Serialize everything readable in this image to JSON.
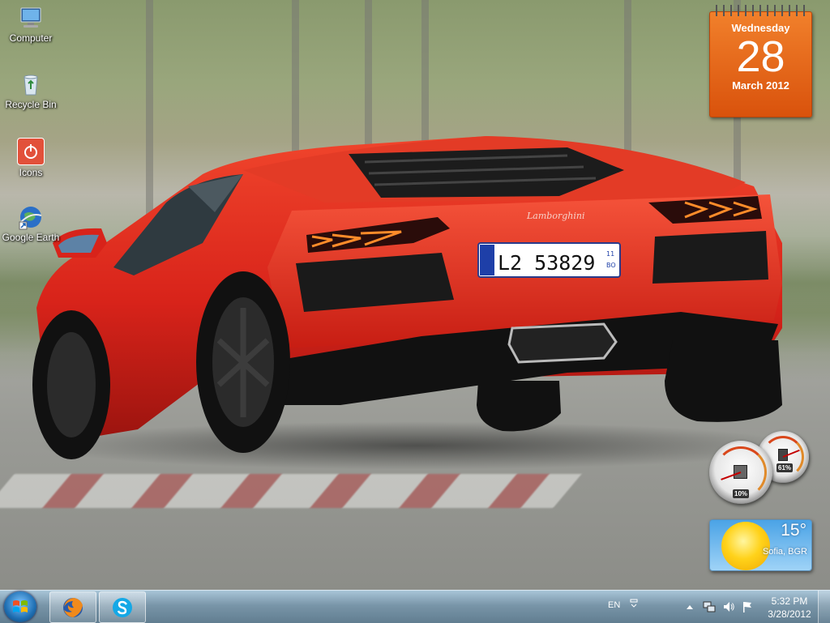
{
  "desktop": {
    "icons": [
      {
        "label": "Computer",
        "icon": "computer-icon"
      },
      {
        "label": "Recycle Bin",
        "icon": "recycle-bin-icon"
      },
      {
        "label": "Icons",
        "icon": "power-icon"
      },
      {
        "label": "Google Earth",
        "icon": "google-earth-icon"
      }
    ],
    "wallpaper": {
      "license_plate": "L2 53829",
      "plate_year": "11",
      "plate_province": "BO",
      "badge": "Lamborghini"
    }
  },
  "gadgets": {
    "calendar": {
      "weekday": "Wednesday",
      "day": "28",
      "month_year": "March 2012"
    },
    "meter": {
      "cpu_label": "10%",
      "ram_label": "61%"
    },
    "weather": {
      "temperature": "15°",
      "location": "Sofia, BGR"
    }
  },
  "taskbar": {
    "pinned": [
      {
        "name": "firefox",
        "icon": "firefox-icon"
      },
      {
        "name": "skype",
        "icon": "skype-icon"
      }
    ],
    "language": "EN",
    "clock": {
      "time": "5:32 PM",
      "date": "3/28/2012"
    }
  },
  "colors": {
    "calendar_orange": "#e86a1d",
    "car_red": "#d8231a",
    "weather_sky": "#4aa3e6",
    "taskbar_blue": "#7f9fb5"
  }
}
